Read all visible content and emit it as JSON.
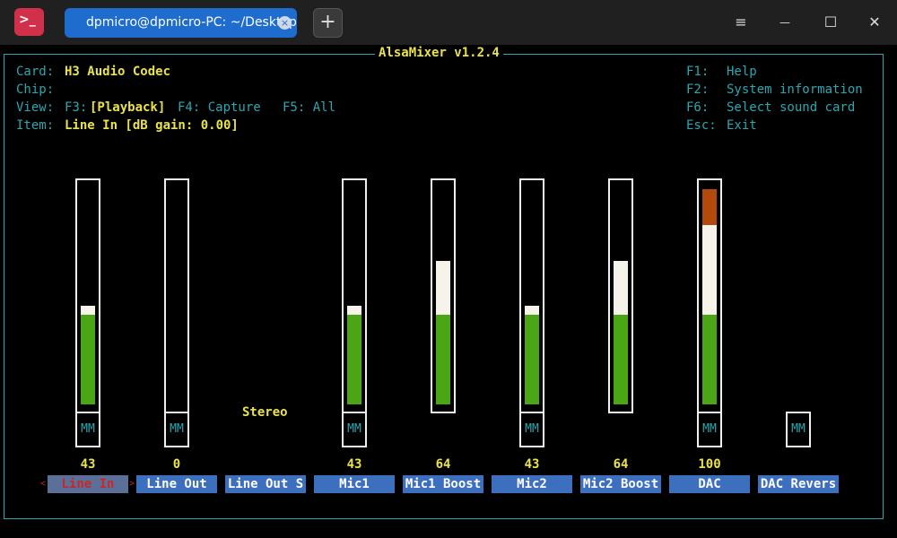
{
  "window": {
    "tab_title": "dpmicro@dpmicro-PC: ~/Desktop",
    "app_icon": ">_",
    "tab_close": "×",
    "new_tab": "+",
    "controls": {
      "menu": "≡",
      "minimize": "—",
      "maximize": "☐",
      "close": "✕"
    }
  },
  "mixer": {
    "title": "AlsaMixer v1.2.4",
    "card_label": "Card:",
    "card_value": "H3 Audio Codec",
    "chip_label": "Chip:",
    "view_label": "View:",
    "view_f3": "F3:",
    "view_playback": "[Playback]",
    "view_capture": "F4: Capture",
    "view_all": "F5: All",
    "item_label": "Item:",
    "item_value": "Line In [dB gain: 0.00]",
    "keys": [
      {
        "key": "F1:",
        "desc": "Help"
      },
      {
        "key": "F2:",
        "desc": "System information"
      },
      {
        "key": "F6:",
        "desc": "Select sound card"
      },
      {
        "key": "Esc:",
        "desc": "Exit"
      }
    ],
    "stereo": "Stereo",
    "mm": "MM",
    "sel_left": "<",
    "sel_right": ">",
    "channels": [
      {
        "name": "Line In",
        "value": "43",
        "level": 0.43,
        "selected": true,
        "has_bar": true,
        "has_mm": true
      },
      {
        "name": "Line Out",
        "value": "0",
        "level": 0.0,
        "selected": false,
        "has_bar": true,
        "has_mm": true
      },
      {
        "name": "Line Out S",
        "value": "",
        "level": 0,
        "selected": false,
        "has_bar": false,
        "has_mm": false
      },
      {
        "name": "Mic1",
        "value": "43",
        "level": 0.43,
        "selected": false,
        "has_bar": true,
        "has_mm": true
      },
      {
        "name": "Mic1 Boost",
        "value": "64",
        "level": 0.64,
        "selected": false,
        "has_bar": true,
        "has_mm": false
      },
      {
        "name": "Mic2",
        "value": "43",
        "level": 0.43,
        "selected": false,
        "has_bar": true,
        "has_mm": true
      },
      {
        "name": "Mic2 Boost",
        "value": "64",
        "level": 0.64,
        "selected": false,
        "has_bar": true,
        "has_mm": false
      },
      {
        "name": "DAC",
        "value": "100",
        "level": 1.0,
        "selected": false,
        "has_bar": true,
        "has_mm": true
      },
      {
        "name": "DAC Revers",
        "value": "",
        "level": 0,
        "selected": false,
        "has_bar": false,
        "has_mm": true
      }
    ],
    "colors": {
      "green": "#4aa615",
      "white": "#f5f3ea",
      "red": "#b34a0c",
      "cyan": "#2aa7b0",
      "yellow": "#e9e24a"
    }
  }
}
